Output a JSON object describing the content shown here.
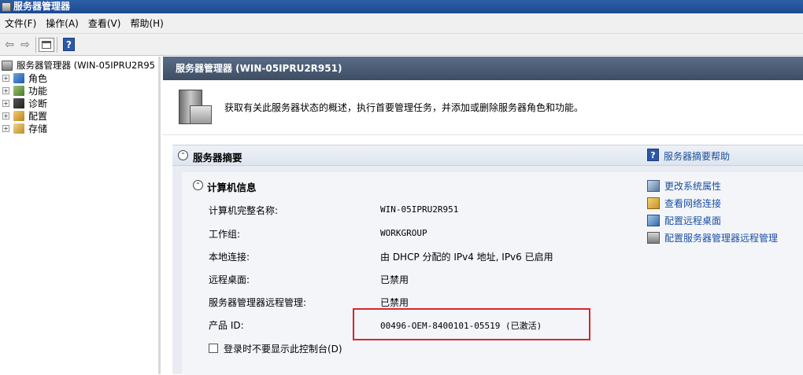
{
  "window": {
    "title": "服务器管理器"
  },
  "menu": [
    {
      "label": "文件(F)"
    },
    {
      "label": "操作(A)"
    },
    {
      "label": "查看(V)"
    },
    {
      "label": "帮助(H)"
    }
  ],
  "tree": {
    "root": "服务器管理器 (WIN-05IPRU2R95",
    "children": [
      {
        "label": "角色",
        "icon": "roles-icon"
      },
      {
        "label": "功能",
        "icon": "features-icon"
      },
      {
        "label": "诊断",
        "icon": "diagnostics-icon"
      },
      {
        "label": "配置",
        "icon": "configuration-icon"
      },
      {
        "label": "存储",
        "icon": "storage-icon"
      }
    ]
  },
  "main": {
    "header": "服务器管理器 (WIN-05IPRU2R951)",
    "intro": "获取有关此服务器状态的概述，执行首要管理任务，并添加或删除服务器角色和功能。"
  },
  "summary": {
    "title": "服务器摘要",
    "help_link": "服务器摘要帮助",
    "computer_info": {
      "title": "计算机信息",
      "rows": [
        {
          "label": "计算机完整名称:",
          "value": "WIN-05IPRU2R951"
        },
        {
          "label": "工作组:",
          "value": "WORKGROUP"
        },
        {
          "label": "本地连接:",
          "value": "由 DHCP 分配的 IPv4 地址, IPv6 已启用"
        },
        {
          "label": "远程桌面:",
          "value": "已禁用"
        },
        {
          "label": "服务器管理器远程管理:",
          "value": "已禁用"
        },
        {
          "label": "产品 ID:",
          "value": "00496-OEM-8400101-05519 (已激活)"
        }
      ],
      "checkbox_label": "登录时不要显示此控制台(D)"
    },
    "tasks": [
      {
        "label": "更改系统属性"
      },
      {
        "label": "查看网络连接"
      },
      {
        "label": "配置远程桌面"
      },
      {
        "label": "配置服务器管理器远程管理"
      }
    ]
  },
  "colors": {
    "link": "#1b4fa0",
    "highlight_box": "#d9262b",
    "header": "#4a5b73"
  }
}
